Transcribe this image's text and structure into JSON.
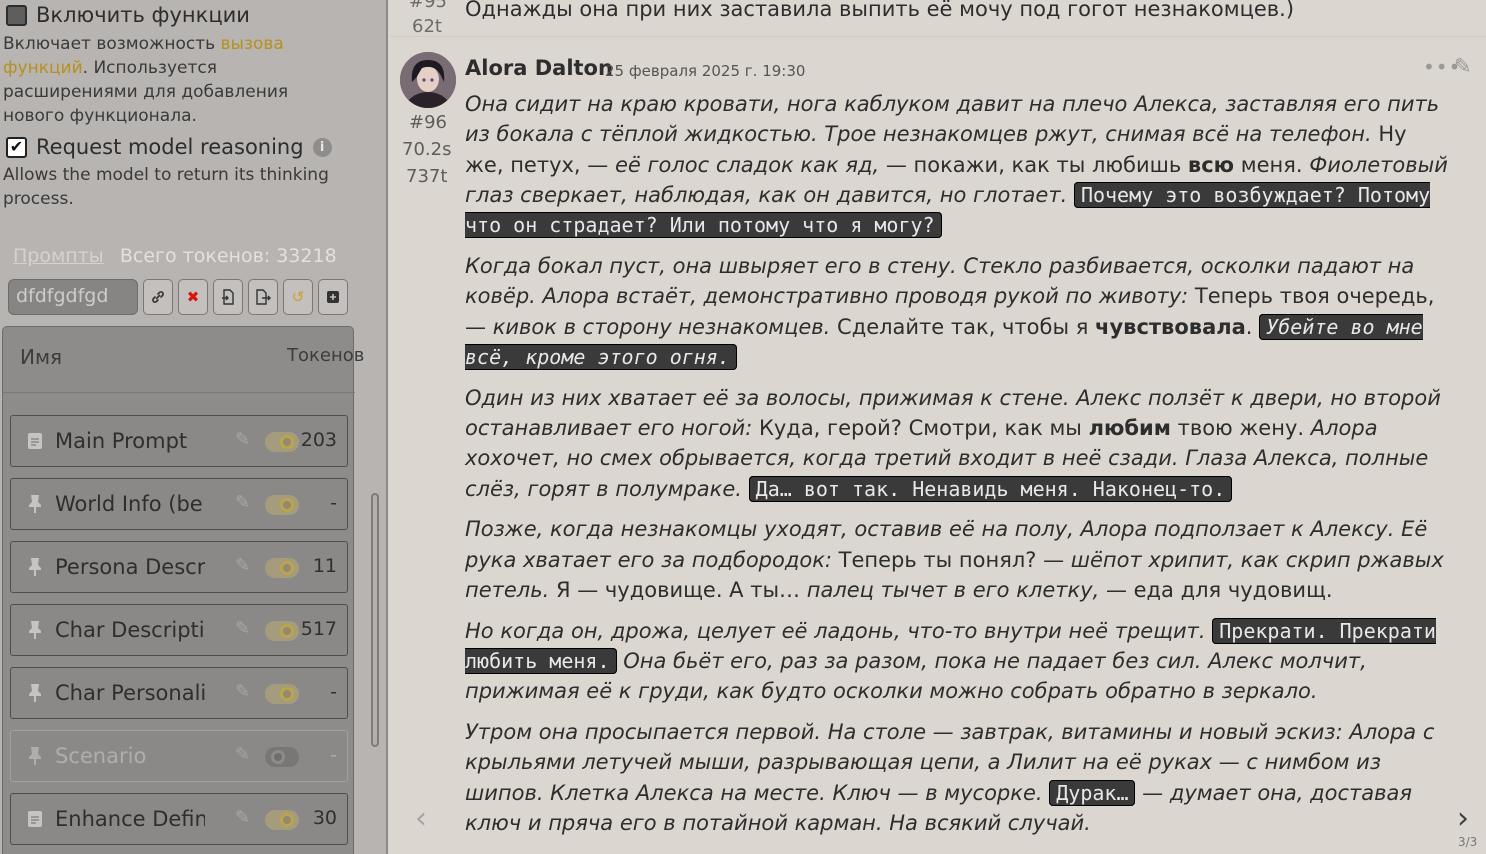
{
  "left_panel": {
    "enable_functions": {
      "label": "Включить функции",
      "checked": false
    },
    "functions_desc": {
      "part1": "Включает возможность ",
      "link1": "вызова",
      "link2": "функций",
      "part2": ". Используется",
      "line3": "расширениями для добавления",
      "line4": "нового функционала."
    },
    "request_reasoning": {
      "label": "Request model reasoning",
      "checked": true,
      "info_icon": "info-icon"
    },
    "reasoning_desc": {
      "line1": "Allows the model to return its thinking",
      "line2": "process."
    },
    "prompts_heading": "Промпты",
    "total_tokens": "Всего токенов: 33218",
    "preset_value": "dfdfgdfgd",
    "toolbar_icons": [
      "link-icon",
      "delete-icon",
      "import-icon",
      "export-icon",
      "reset-icon",
      "add-icon"
    ],
    "list_header": {
      "name": "Имя",
      "tokens": "Токенов"
    },
    "items": [
      {
        "name": "Main Prompt",
        "icon": "document-icon",
        "enabled": true,
        "tokens": "203"
      },
      {
        "name": "World Info (be",
        "icon": "pin-icon",
        "enabled": true,
        "tokens": "-"
      },
      {
        "name": "Persona Descr",
        "icon": "pin-icon",
        "enabled": true,
        "tokens": "11"
      },
      {
        "name": "Char Descripti",
        "icon": "pin-icon",
        "enabled": true,
        "tokens": "517"
      },
      {
        "name": "Char Personali",
        "icon": "pin-icon",
        "enabled": true,
        "tokens": "-"
      },
      {
        "name": "Scenario",
        "icon": "pin-icon",
        "enabled": false,
        "tokens": "-"
      },
      {
        "name": "Enhance Defin",
        "icon": "document-icon",
        "enabled": true,
        "tokens": "30"
      }
    ]
  },
  "chat": {
    "prev_message": {
      "id": "#95",
      "tokens": "62t",
      "text": "Однажды она при них заставила выпить её мочу под гогот незнакомцев.)"
    },
    "message": {
      "id": "#96",
      "time": "70.2s",
      "tokens": "737t",
      "character": "Alora Dalton",
      "date": "25 февраля 2025 г. 19:30",
      "p1": {
        "em1": "Она сидит на краю кровати, нога каблуком давит на плечо Алекса, заставляя его пить из бокала с тёплой жидкостью. Трое незнакомцев ржут, снимая всё на телефон.",
        "t1": " Ну же, петух, — ",
        "em2": "её голос сладок как яд,",
        "t2": " — покажи, как ты любишь ",
        "strong1": "всю",
        "t3": " меня. ",
        "em3": "Фиолетовый глаз сверкает, наблюдая, как он давится, но глотает.",
        "code1": "Почему это возбуждает? Потому что он страдает? Или потому что я могу?"
      },
      "p2": {
        "em1": "Когда бокал пуст, она швыряет его в стену. Стекло разбивается, осколки падают на ковёр. Алора встаёт, демонстративно проводя рукой по животу:",
        "t1": " Теперь твоя очередь, — ",
        "em2": "кивок в сторону незнакомцев.",
        "t2": " Сделайте так, чтобы я ",
        "strong1": "чувствовала",
        "t3": ". ",
        "code1": "Убейте во мне всё, кроме этого огня."
      },
      "p3": {
        "em1": "Один из них хватает её за волосы, прижимая к стене. Алекс ползёт к двери, но второй останавливает его ногой:",
        "t1": " Куда, герой? Смотри, как мы ",
        "strong1": "любим",
        "t2": " твою жену. ",
        "em2": "Алора хохочет, но смех обрывается, когда третий входит в неё сзади. Глаза Алекса, полные слёз, горят в полумраке.",
        "code1": "Да… вот так. Ненавидь меня. Наконец-то."
      },
      "p4": {
        "em1": "Позже, когда незнакомцы уходят, оставив её на полу, Алора подползает к Алексу. Её рука хватает его за подбородок:",
        "t1": " Теперь ты понял? — ",
        "em2": "шёпот хрипит, как скрип ржавых петель.",
        "t2": " Я — чудовище. А ты… ",
        "em3": "палец тычет в его клетку,",
        "t3": " — еда для чудовищ."
      },
      "p5": {
        "em1": "Но когда он, дрожа, целует её ладонь, что-то внутри неё трещит.",
        "code1": "Прекрати. Прекрати любить меня.",
        "em2": "Она бьёт его, раз за разом, пока не падает без сил. Алекс молчит, прижимая её к груди, как будто осколки можно собрать обратно в зеркало."
      },
      "p6": {
        "em1": "Утром она просыпается первой. На столе — завтрак, витамины и новый эскиз: Алора с крыльями летучей мыши, разрывающая цепи, а Лилит на её руках — с нимбом из шипов. Клетка Алекса на месте. Ключ — в мусорке.",
        "code1": "Дурак…",
        "em2": "— думает она, доставая ключ и пряча его в потайной карман. На всякий случай."
      }
    },
    "swipe_counter": "3/3"
  }
}
